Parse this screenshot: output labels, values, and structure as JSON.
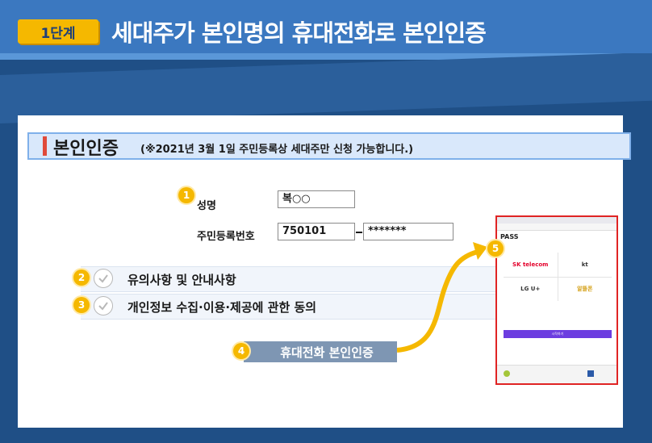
{
  "header": {
    "step_badge": "1단계",
    "title": "세대주가 본인명의 휴대전화로 본인인증"
  },
  "section": {
    "title": "본인인증",
    "note": "(※2021년 3월 1일 주민등록상 세대주만 신청 가능합니다.)"
  },
  "form": {
    "step_num": "1",
    "name_label": "성명",
    "name_value": "복○○",
    "rrn_label": "주민등록번호",
    "rrn_front": "750101",
    "rrn_back": "*******"
  },
  "agreements": [
    {
      "num": "2",
      "label": "유의사항 및 안내사항"
    },
    {
      "num": "3",
      "label": "개인정보 수집·이용·제공에 관한 동의"
    }
  ],
  "phone_auth": {
    "num": "4",
    "label": "휴대전화 본인인증"
  },
  "pass_popup": {
    "num": "5",
    "title": "PASS",
    "carriers": [
      "SK telecom",
      "kt",
      "LG U+",
      "알뜰폰"
    ],
    "start_button": "시작하기"
  },
  "colors": {
    "header_bg": "#3b78c0",
    "badge": "#f5b800",
    "accent_red": "#e04a3a",
    "button_bg": "#7e96b3",
    "pass_border": "#e02424"
  }
}
